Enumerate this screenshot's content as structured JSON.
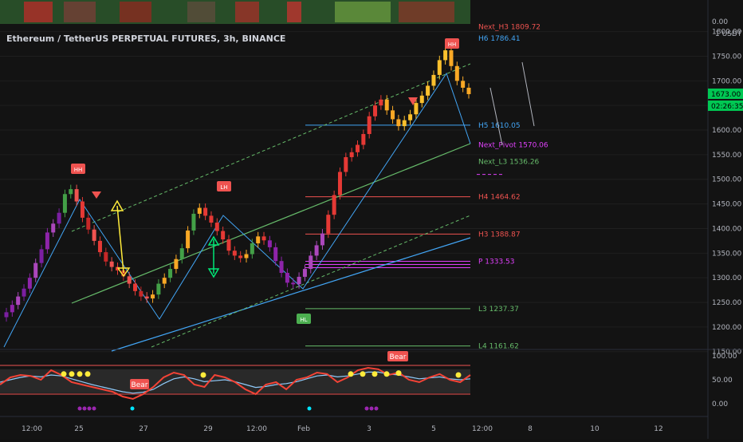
{
  "header": {
    "title": "Ethereum / TetherUS PERPETUAL FUTURES, 3h, BINANCE",
    "currency": "1 USDT",
    "top_value": "0.00"
  },
  "price_badges": {
    "price": "1673.00",
    "countdown": "02:26:35",
    "color": "#00c853"
  },
  "chart_data": {
    "type": "candlestick",
    "title": "Ethereum / TetherUS PERPETUAL FUTURES, 3h, BINANCE",
    "y_axis": {
      "ticks": [
        "1800.00",
        "1750.00",
        "1700.00",
        "1650.00",
        "1600.00",
        "1550.00",
        "1500.00",
        "1450.00",
        "1400.00",
        "1350.00",
        "1300.00",
        "1250.00",
        "1200.00",
        "1150.00"
      ],
      "ylim": [
        1135,
        1835
      ]
    },
    "x_axis": {
      "ticks": [
        "12:00",
        "25",
        "27",
        "29",
        "12:00",
        "Feb",
        "3",
        "5",
        "12:00",
        "8",
        "10",
        "12"
      ]
    },
    "close_path": [
      1230,
      1245,
      1262,
      1278,
      1300,
      1330,
      1358,
      1392,
      1410,
      1432,
      1470,
      1480,
      1455,
      1422,
      1398,
      1375,
      1352,
      1333,
      1322,
      1315,
      1303,
      1288,
      1273,
      1262,
      1258,
      1266,
      1288,
      1300,
      1318,
      1338,
      1360,
      1396,
      1430,
      1442,
      1426,
      1412,
      1395,
      1378,
      1355,
      1345,
      1340,
      1348,
      1370,
      1384,
      1376,
      1362,
      1334,
      1310,
      1290,
      1287,
      1302,
      1318,
      1345,
      1366,
      1390,
      1428,
      1468,
      1515,
      1545,
      1555,
      1570,
      1592,
      1628,
      1650,
      1662,
      1640,
      1622,
      1608,
      1620,
      1632,
      1655,
      1670,
      1690,
      1712,
      1742,
      1762,
      1730,
      1700,
      1686,
      1673
    ],
    "levels": [
      {
        "label": "Next_H3 1809.72",
        "value": 1809.72,
        "color": "#ef5350"
      },
      {
        "label": "H6 1786.41",
        "value": 1786.41,
        "color": "#42a5f5"
      },
      {
        "label": "H5 1610.05",
        "value": 1610.05,
        "color": "#42a5f5"
      },
      {
        "label": "Next_Pivot 1570.06",
        "value": 1570.06,
        "color": "#e040fb"
      },
      {
        "label": "Next_L3 1536.26",
        "value": 1536.26,
        "color": "#66bb6a"
      },
      {
        "label": "H4 1464.62",
        "value": 1464.62,
        "color": "#ef5350"
      },
      {
        "label": "H3 1388.87",
        "value": 1388.87,
        "color": "#ef5350"
      },
      {
        "label": "P 1333.53",
        "value": 1333.53,
        "color": "#e040fb"
      },
      {
        "label": "L3 1237.37",
        "value": 1237.37,
        "color": "#66bb6a"
      },
      {
        "label": "L4 1161.62",
        "value": 1161.62,
        "color": "#66bb6a"
      }
    ],
    "annotations": {
      "markers": [
        "HH",
        "LH",
        "HL",
        "HH"
      ],
      "bear_label": "Bear"
    },
    "oscillator": {
      "ticks": [
        "100.00",
        "50.00",
        "0.00"
      ],
      "ylim": [
        -15,
        110
      ],
      "red_line": [
        40,
        55,
        60,
        58,
        50,
        70,
        60,
        45,
        40,
        35,
        30,
        25,
        15,
        10,
        20,
        35,
        55,
        65,
        60,
        40,
        35,
        60,
        55,
        45,
        30,
        20,
        40,
        45,
        30,
        50,
        55,
        65,
        62,
        45,
        55,
        70,
        75,
        72,
        60,
        65,
        50,
        45,
        55,
        62,
        50,
        45,
        60
      ],
      "blue_line": [
        45,
        50,
        55,
        58,
        56,
        60,
        58,
        52,
        46,
        40,
        35,
        30,
        25,
        22,
        24,
        30,
        42,
        52,
        56,
        52,
        46,
        48,
        50,
        46,
        40,
        34,
        36,
        40,
        42,
        46,
        52,
        58,
        60,
        56,
        58,
        62,
        66,
        66,
        62,
        60,
        56,
        52,
        54,
        56,
        52,
        50,
        52
      ]
    },
    "mark_colors": {
      "up": "#26a69a",
      "down": "#ef5350",
      "yellow": "#ffeb3b",
      "purple": "#9c27b0",
      "orange": "#ff9800"
    }
  }
}
